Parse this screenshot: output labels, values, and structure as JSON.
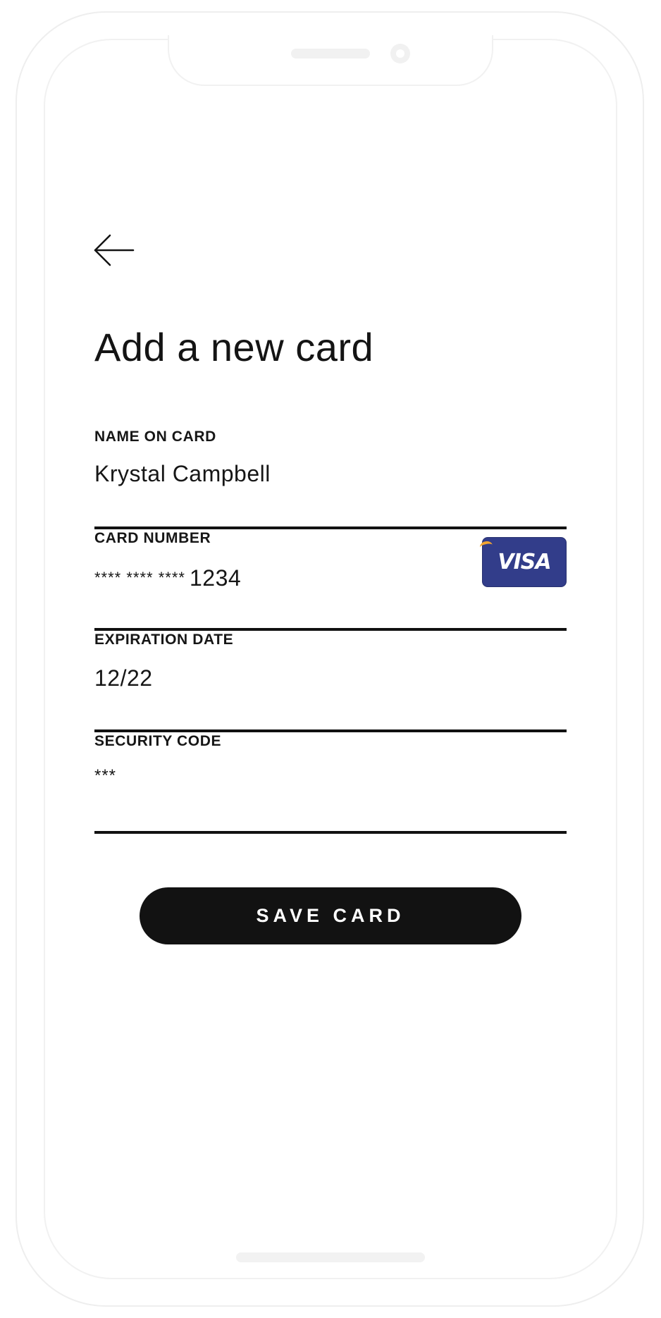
{
  "header": {
    "back_icon": "arrow-left-icon",
    "title": "Add a new card"
  },
  "form": {
    "name": {
      "label": "NAME ON CARD",
      "value": "Krystal Campbell"
    },
    "card_number": {
      "label": "CARD NUMBER",
      "masked": "**** **** ****",
      "last4": "1234",
      "brand": "VISA",
      "brand_color": "#323d8a",
      "brand_accent": "#f2a531"
    },
    "expiration": {
      "label": "EXPIRATION DATE",
      "value": "12/22"
    },
    "security_code": {
      "label": "SECURITY CODE",
      "value": "***"
    }
  },
  "actions": {
    "save_label": "SAVE CARD"
  },
  "colors": {
    "text": "#151515",
    "button_bg": "#121212",
    "frame": "#eeeeee"
  }
}
